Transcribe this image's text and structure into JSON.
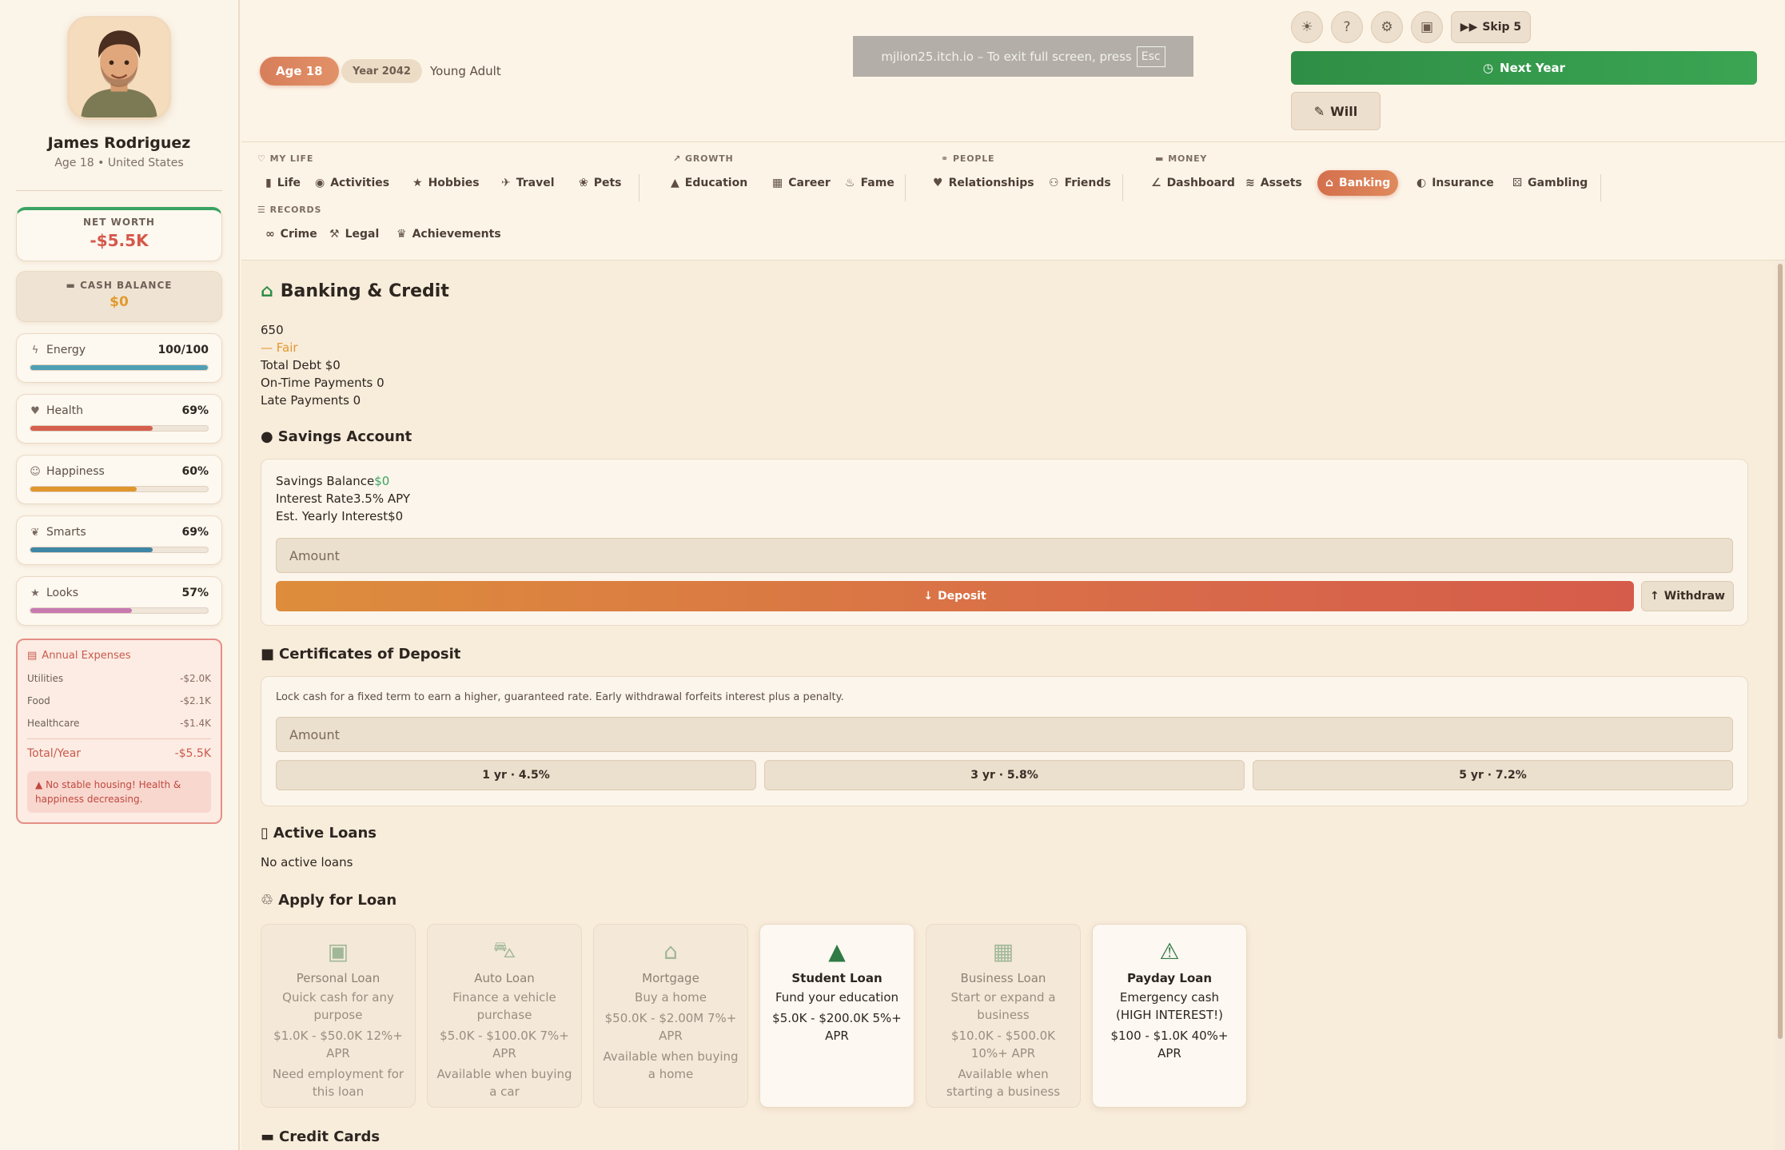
{
  "player": {
    "name": "James Rodriguez",
    "subtitle": "Age 18 • United States"
  },
  "sidebar": {
    "net_worth_label": "NET WORTH",
    "net_worth_value": "-$5.5K",
    "cash_label": "CASH BALANCE",
    "cash_value": "$0",
    "stats": [
      {
        "name": "Energy",
        "value": "100/100",
        "level": 1.0,
        "color": "#4f9fb4"
      },
      {
        "name": "Health",
        "value": "69%",
        "level": 0.69,
        "color": "#d5604d"
      },
      {
        "name": "Happiness",
        "value": "60%",
        "level": 0.6,
        "color": "#e0962d"
      },
      {
        "name": "Smarts",
        "value": "69%",
        "level": 0.69,
        "color": "#3e86a4"
      },
      {
        "name": "Looks",
        "value": "57%",
        "level": 0.57,
        "color": "#c77ab0"
      }
    ],
    "expenses": {
      "title": "Annual Expenses",
      "rows": [
        {
          "label": "Utilities",
          "amount": "-$2.0K"
        },
        {
          "label": "Food",
          "amount": "-$2.1K"
        },
        {
          "label": "Healthcare",
          "amount": "-$1.4K"
        }
      ],
      "total_label": "Total/Year",
      "total_amount": "-$5.5K",
      "warning": "No stable housing! Health & happiness decreasing."
    }
  },
  "header": {
    "age": "Age 18",
    "year": "Year 2042",
    "stage": "Young Adult",
    "fullscreen_notice": "mjlion25.itch.io – To exit full screen, press",
    "fullscreen_key": "Esc",
    "skip_label": "Skip 5",
    "next_year_label": "Next Year",
    "will_label": "Will"
  },
  "nav": {
    "groups": {
      "my_life": "MY LIFE",
      "growth": "GROWTH",
      "people": "PEOPLE",
      "money": "MONEY",
      "records": "RECORDS"
    },
    "items": {
      "life": "Life",
      "activities": "Activities",
      "hobbies": "Hobbies",
      "travel": "Travel",
      "pets": "Pets",
      "education": "Education",
      "career": "Career",
      "fame": "Fame",
      "relationships": "Relationships",
      "friends": "Friends",
      "dashboard": "Dashboard",
      "assets": "Assets",
      "banking": "Banking",
      "insurance": "Insurance",
      "gambling": "Gambling",
      "crime": "Crime",
      "legal": "Legal",
      "achievements": "Achievements"
    }
  },
  "main": {
    "title": "Banking & Credit",
    "credit": {
      "score": "650",
      "rating": "— Fair",
      "total_debt": "Total Debt $0",
      "on_time": "On-Time Payments 0",
      "late": "Late Payments 0"
    },
    "savings": {
      "title": "Savings Account",
      "balance_label": "Savings Balance",
      "balance_value": "$0",
      "rate": "Interest Rate3.5% APY",
      "yearly": "Est. Yearly Interest$0",
      "amount_placeholder": "Amount",
      "deposit_label": "Deposit",
      "withdraw_label": "Withdraw"
    },
    "cds": {
      "title": "Certificates of Deposit",
      "description": "Lock cash for a fixed term to earn a higher, guaranteed rate. Early withdrawal forfeits interest plus a penalty.",
      "amount_placeholder": "Amount",
      "options": [
        "1 yr · 4.5%",
        "3 yr · 5.8%",
        "5 yr · 7.2%"
      ]
    },
    "active_loans": {
      "title": "Active Loans",
      "empty": "No active loans"
    },
    "apply": {
      "title": "Apply for Loan",
      "loans": [
        {
          "name": "Personal Loan",
          "desc": "Quick cash for any purpose",
          "range": "$1.0K - $50.0K 12%+ APR",
          "note": "Need employment for this loan",
          "icon": "cash-icon"
        },
        {
          "name": "Auto Loan",
          "desc": "Finance a vehicle purchase",
          "range": "$5.0K - $100.0K 7%+ APR",
          "note": "Available when buying a car",
          "icon": "car-icon"
        },
        {
          "name": "Mortgage",
          "desc": "Buy a home",
          "range": "$50.0K - $2.00M 7%+ APR",
          "note": "Available when buying a home",
          "icon": "house-icon"
        },
        {
          "name": "Student Loan",
          "desc": "Fund your education",
          "range": "$5.0K - $200.0K 5%+ APR",
          "note": "",
          "icon": "graduation-cap-icon"
        },
        {
          "name": "Business Loan",
          "desc": "Start or expand a business",
          "range": "$10.0K - $500.0K 10%+ APR",
          "note": "Available when starting a business",
          "icon": "briefcase-icon"
        },
        {
          "name": "Payday Loan",
          "desc": "Emergency cash (HIGH INTEREST!)",
          "range": "$100 - $1.0K 40%+ APR",
          "note": "",
          "icon": "warning-icon"
        }
      ]
    },
    "credit_cards_title": "Credit Cards"
  }
}
